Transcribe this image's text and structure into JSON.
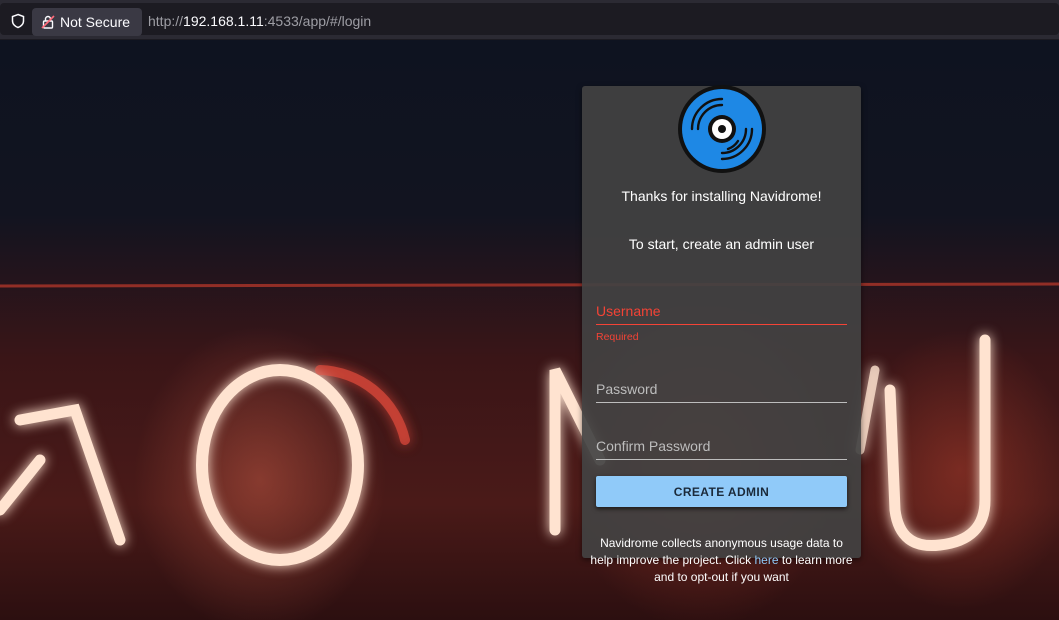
{
  "browser": {
    "security_label": "Not Secure",
    "url_scheme": "http://",
    "url_host": "192.168.1.11",
    "url_rest": ":4533/app/#/login"
  },
  "login": {
    "welcome": "Thanks for installing Navidrome!",
    "instruction": "To start, create an admin user",
    "username_placeholder": "Username",
    "username_helper": "Required",
    "password_placeholder": "Password",
    "confirm_placeholder": "Confirm Password",
    "submit_label": "CREATE ADMIN",
    "footer_before": "Navidrome collects anonymous usage data to help improve the project. Click ",
    "footer_link": "here",
    "footer_after": " to learn more and to opt-out if you want"
  },
  "colors": {
    "accent": "#90caf9",
    "error": "#f44336",
    "logo_blue": "#1e88e5"
  }
}
